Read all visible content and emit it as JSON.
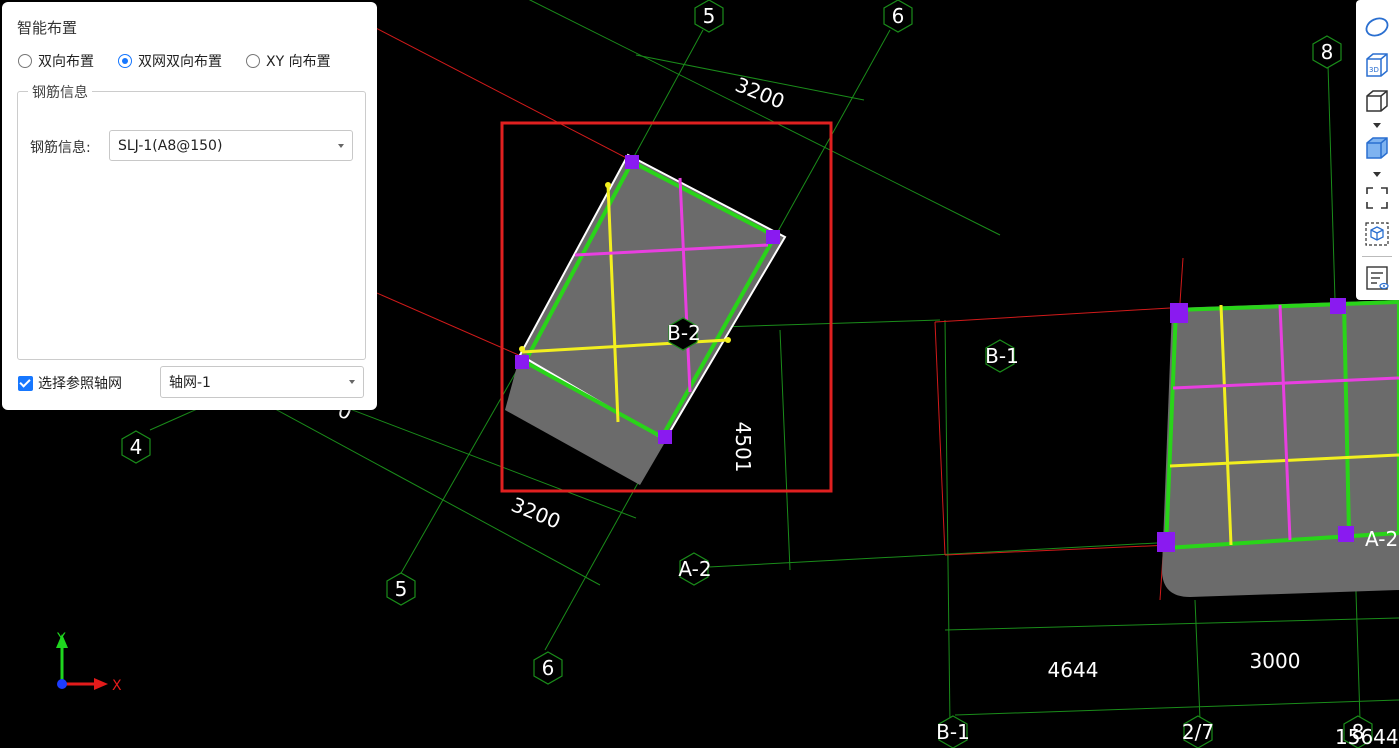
{
  "panel": {
    "title": "智能布置",
    "modes": [
      {
        "label": "双向布置",
        "checked": false
      },
      {
        "label": "双网双向布置",
        "checked": true
      },
      {
        "label": "XY 向布置",
        "checked": false
      }
    ],
    "rebar_group": {
      "legend": "钢筋信息",
      "field_label": "钢筋信息:",
      "field_value": "SLJ-1(A8@150)"
    },
    "ref_grid": {
      "checkbox_label": "选择参照轴网",
      "checked": true,
      "grid_value": "轴网-1"
    }
  },
  "canvas": {
    "axis_labels": [
      "5",
      "6",
      "8",
      "4",
      "5",
      "6",
      "B-1",
      "A-2",
      "B-1",
      "2/7",
      "8"
    ],
    "slab_labels": [
      "B-2",
      "A-2"
    ],
    "dimensions": [
      "3200",
      "3200",
      "4501",
      "4644",
      "3000",
      "15644"
    ],
    "partial_label": "0",
    "colors": {
      "grid_line": "#1a8c1a",
      "red_line": "#d11a1a",
      "slab_fill": "#6b6b6b",
      "beam": "#29d419",
      "rebar_x": "#f2ef1f",
      "rebar_y": "#e83fe0",
      "column": "#8a1af0",
      "highlight": "#e02020"
    }
  },
  "toolbar": {
    "tools": [
      "orbit-icon",
      "view-3d-icon",
      "box-view-icon",
      "solid-view-icon",
      "region-select-icon",
      "component-box-icon",
      "properties-view-icon"
    ]
  },
  "axis_gizmo": {
    "x_label": "X",
    "y_label": "Y"
  }
}
